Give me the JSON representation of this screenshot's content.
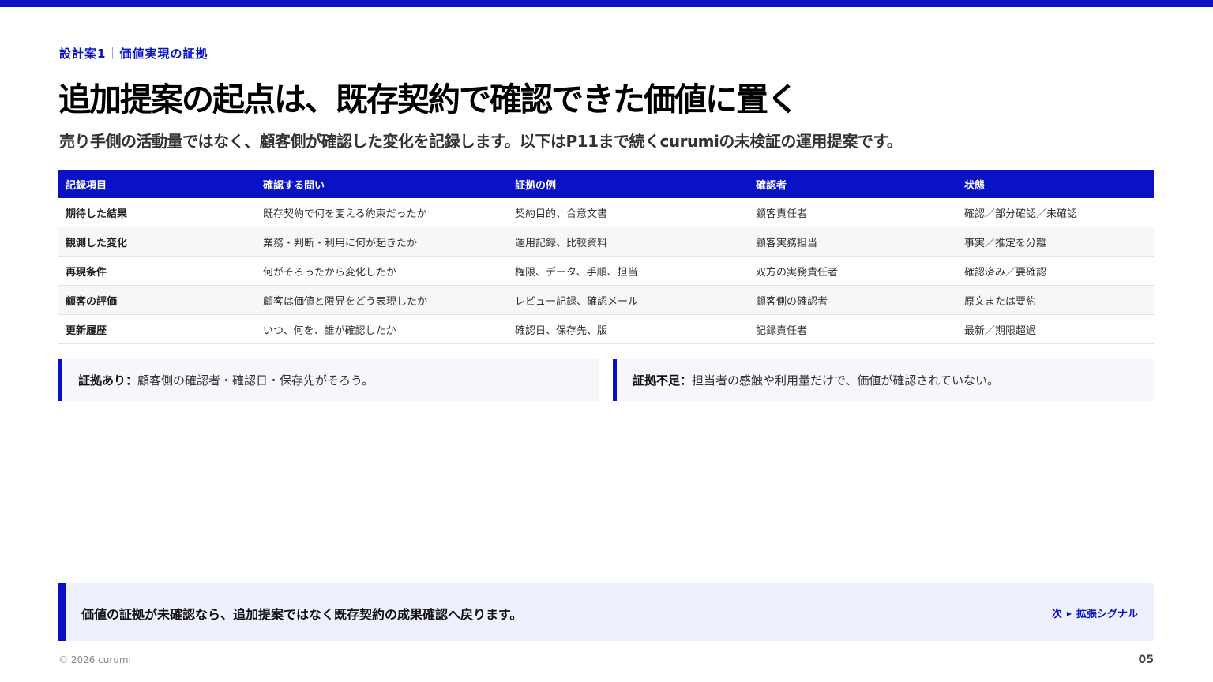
{
  "header": {
    "section_label": "設計案1",
    "section_topic": "価値実現の証拠",
    "title": "追加提案の起点は、既存契約で確認できた価値に置く",
    "subtitle": "売り手側の活動量ではなく、顧客側が確認した変化を記録します。以下はP11まで続くcurumiの未検証の運用提案です。"
  },
  "table": {
    "headers": [
      "記録項目",
      "確認する問い",
      "証拠の例",
      "確認者",
      "状態"
    ],
    "rows": [
      [
        "期待した結果",
        "既存契約で何を変える約束だったか",
        "契約目的、合意文書",
        "顧客責任者",
        "確認／部分確認／未確認"
      ],
      [
        "観測した変化",
        "業務・判断・利用に何が起きたか",
        "運用記録、比較資料",
        "顧客実務担当",
        "事実／推定を分離"
      ],
      [
        "再現条件",
        "何がそろったから変化したか",
        "権限、データ、手順、担当",
        "双方の実務責任者",
        "確認済み／要確認"
      ],
      [
        "顧客の評価",
        "顧客は価値と限界をどう表現したか",
        "レビュー記録、確認メール",
        "顧客側の確認者",
        "原文または要約"
      ],
      [
        "更新履歴",
        "いつ、何を、誰が確認したか",
        "確認日、保存先、版",
        "記録責任者",
        "最新／期限超過"
      ]
    ]
  },
  "callouts": {
    "left": {
      "lead": "証拠あり：",
      "text": "顧客側の確認者・確認日・保存先がそろう。"
    },
    "right": {
      "lead": "証拠不足：",
      "text": "担当者の感触や利用量だけで、価値が確認されていない。"
    }
  },
  "conclusion": {
    "text": "価値の証拠が未確認なら、追加提案ではなく既存契約の成果確認へ戻ります。",
    "next_prefix": "次",
    "next_label": "拡張シグナル"
  },
  "footer": {
    "copyright": "© 2026 curumi",
    "page_number": "05"
  },
  "colors": {
    "accent": "#0a12c8",
    "callout_bg": "#f6f6fb",
    "conclusion_bg": "#eef0fd"
  }
}
